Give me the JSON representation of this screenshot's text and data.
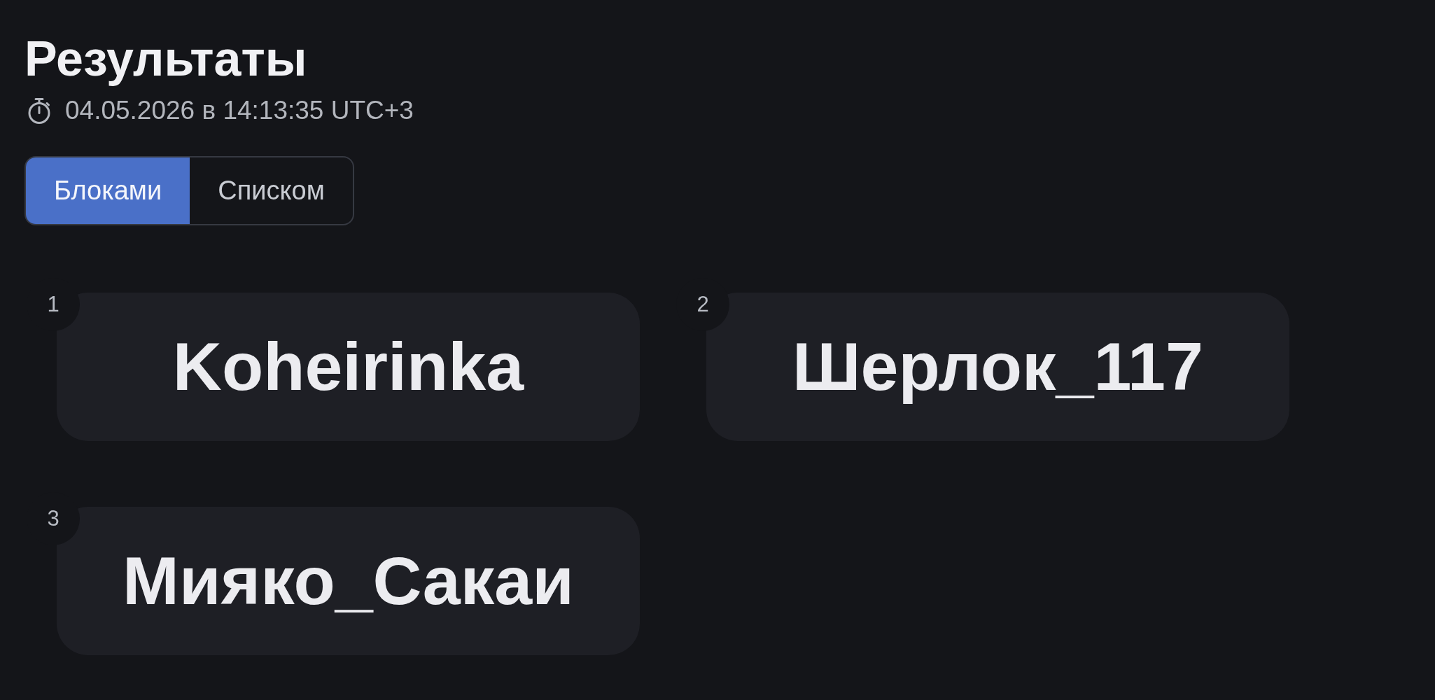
{
  "header": {
    "title": "Результаты",
    "timestamp": "04.05.2026 в 14:13:35 UTC+3"
  },
  "view_switch": [
    {
      "label": "Блоками",
      "selected": true
    },
    {
      "label": "Списком",
      "selected": false
    }
  ],
  "results": [
    {
      "place": "1",
      "name": "Koheirinka"
    },
    {
      "place": "2",
      "name": "Шерлок_117"
    },
    {
      "place": "3",
      "name": "Мияко_Сакаи"
    }
  ]
}
